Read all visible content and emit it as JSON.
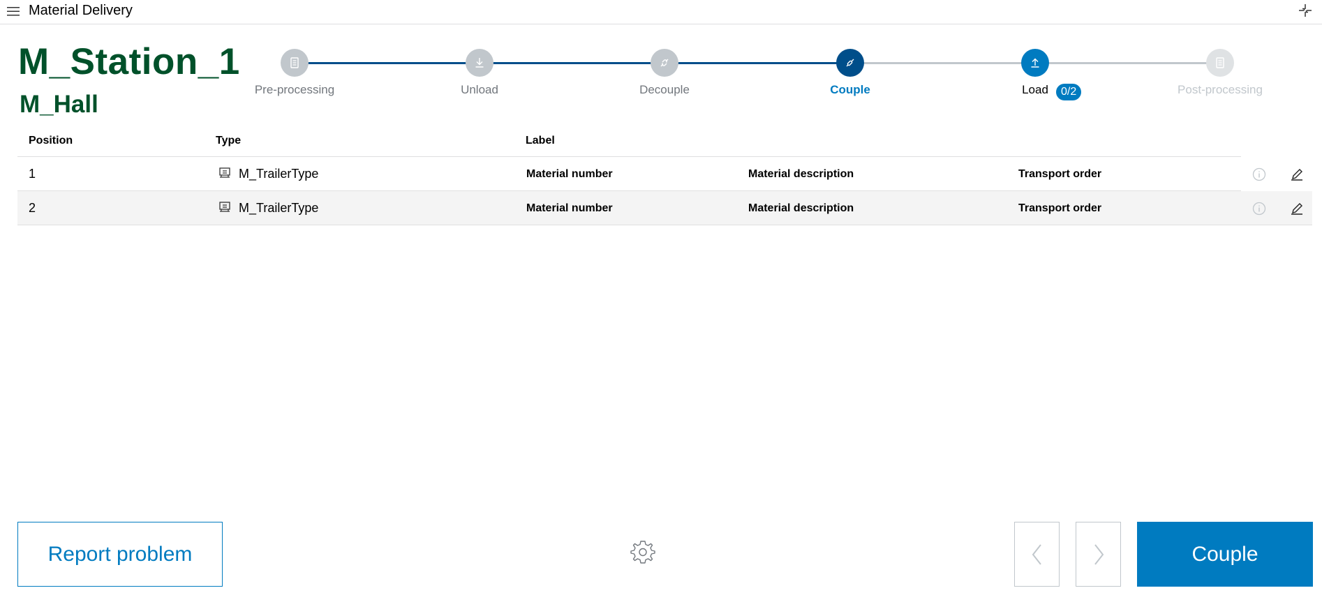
{
  "app": {
    "title": "Material Delivery"
  },
  "header": {
    "station": "M_Station_1",
    "hall": "M_Hall"
  },
  "stepper": {
    "steps": [
      {
        "label": "Pre-processing",
        "icon": "clipboard-icon",
        "state": "past"
      },
      {
        "label": "Unload",
        "icon": "download-icon",
        "state": "past"
      },
      {
        "label": "Decouple",
        "icon": "decouple-icon",
        "state": "past"
      },
      {
        "label": "Couple",
        "icon": "couple-icon",
        "state": "current"
      },
      {
        "label": "Load",
        "icon": "upload-icon",
        "state": "next"
      },
      {
        "label": "Post-processing",
        "icon": "clipboard-icon",
        "state": "future"
      }
    ],
    "load_badge": "0/2"
  },
  "table": {
    "headers": {
      "position": "Position",
      "type": "Type",
      "label": "Label"
    },
    "rows": [
      {
        "position": "1",
        "type": "M_TrailerType",
        "material_number": "Material number",
        "material_description": "Material description",
        "transport_order": "Transport order"
      },
      {
        "position": "2",
        "type": "M_TrailerType",
        "material_number": "Material number",
        "material_description": "Material description",
        "transport_order": "Transport order"
      }
    ]
  },
  "footer": {
    "report_label": "Report problem",
    "primary_label": "Couple"
  },
  "colors": {
    "brand_green": "#00512a",
    "primary_blue": "#007bc0",
    "dark_blue": "#004e8a",
    "inactive_grey": "#c1c7cc"
  }
}
